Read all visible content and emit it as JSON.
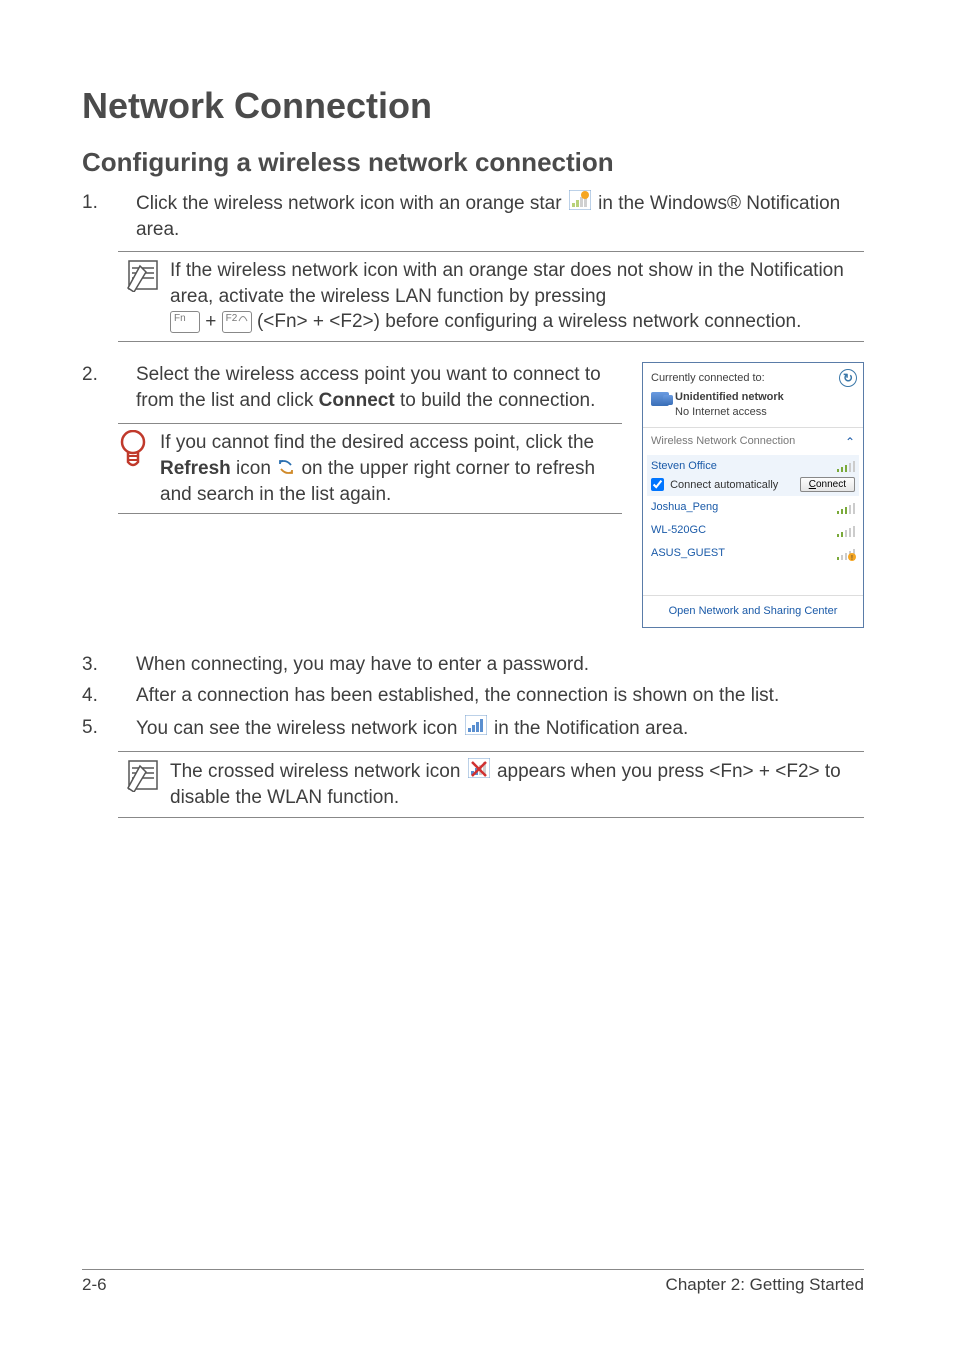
{
  "title": "Network Connection",
  "section": "Configuring a wireless network connection",
  "steps": {
    "s1_pre": "Click the wireless network icon with an orange star",
    "s1_post": "in the Windows® Notification area.",
    "s2": "Select the wireless access point you want to connect to from the list and click ",
    "s2_bold": "Connect",
    "s2_post": " to build the connection.",
    "s3": "When connecting, you may have to enter a password.",
    "s4": "After a connection has been established, the connection is shown on the list.",
    "s5_pre": "You can see the wireless network icon",
    "s5_post": "in the Notification area."
  },
  "note1": {
    "line1": "If the wireless network icon with an orange star does not show in the Notification area, activate the wireless LAN function by pressing",
    "key1": "Fn",
    "plus": " + ",
    "key2": "F2",
    "line2": " (<Fn> + <F2>) before configuring a wireless network connection."
  },
  "tip": {
    "pre": "If you cannot find the desired access point, click the ",
    "bold": "Refresh",
    "mid": " icon ",
    "post": " on the upper right corner to refresh and search in the list again."
  },
  "note2": {
    "pre": "The crossed wireless network icon",
    "post": "appears when you press <Fn> + <F2> to disable the WLAN function."
  },
  "popup": {
    "currently": "Currently connected to:",
    "unid": "Unidentified network",
    "noaccess": "No Internet access",
    "wnc": "Wireless Network Connection",
    "networks": [
      "Steven Office",
      "Joshua_Peng",
      "WL-520GC",
      "ASUS_GUEST"
    ],
    "auto": "Connect automatically",
    "connect_u": "C",
    "connect_rest": "onnect",
    "openlink": "Open Network and Sharing Center"
  },
  "footer": {
    "left": "2-6",
    "right": "Chapter 2: Getting Started"
  }
}
